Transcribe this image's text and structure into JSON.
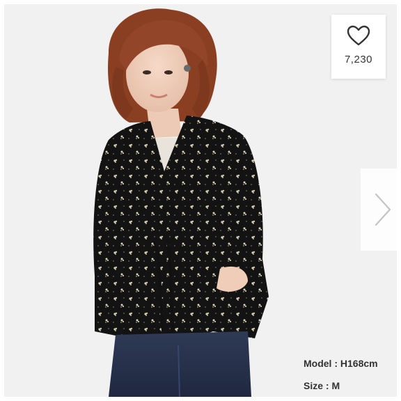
{
  "favorite": {
    "count": "7,230",
    "icon": "heart-outline-icon"
  },
  "navigation": {
    "next_icon": "chevron-right-icon"
  },
  "model_info": {
    "height": "Model : H168cm",
    "size": "Size : M"
  },
  "colors": {
    "background": "#f1f1f2",
    "blouse": "#141414",
    "hair": "#8a3f22",
    "jeans": "#2a344c",
    "text": "#333333"
  }
}
